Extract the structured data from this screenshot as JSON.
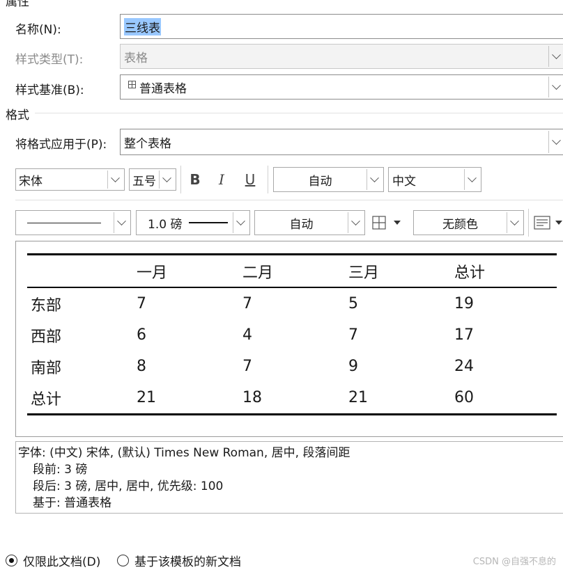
{
  "section_properties": "属性",
  "name": {
    "label": "名称(N):",
    "value": "三线表"
  },
  "style_type": {
    "label": "样式类型(T):",
    "value": "表格"
  },
  "style_based": {
    "label": "样式基准(B):",
    "value": "普通表格",
    "icon": "table-grid-icon"
  },
  "section_format": "格式",
  "apply_to": {
    "label": "将格式应用于(P):",
    "value": "整个表格"
  },
  "font_toolbar": {
    "font": "宋体",
    "size": "五号",
    "bold": "B",
    "italic": "I",
    "underline": "U",
    "color": "自动",
    "script": "中文"
  },
  "border_toolbar": {
    "line_style": "",
    "line_weight": "1.0 磅",
    "border_color": "自动",
    "fill": "无颜色"
  },
  "preview_table": {
    "headers": [
      "",
      "一月",
      "二月",
      "三月",
      "总计"
    ],
    "rows": [
      [
        "东部",
        "7",
        "7",
        "5",
        "19"
      ],
      [
        "西部",
        "6",
        "4",
        "7",
        "17"
      ],
      [
        "南部",
        "8",
        "7",
        "9",
        "24"
      ],
      [
        "总计",
        "21",
        "18",
        "21",
        "60"
      ]
    ]
  },
  "description": [
    "字体: (中文) 宋体, (默认) Times New Roman, 居中, 段落间距",
    "段前: 3 磅",
    "段后: 3 磅, 居中, 居中, 优先级: 100",
    "基于: 普通表格"
  ],
  "options": {
    "only_this_doc": "仅限此文档(D)",
    "new_docs_template": "基于该模板的新文档"
  },
  "watermark": "CSDN @自强不息的"
}
